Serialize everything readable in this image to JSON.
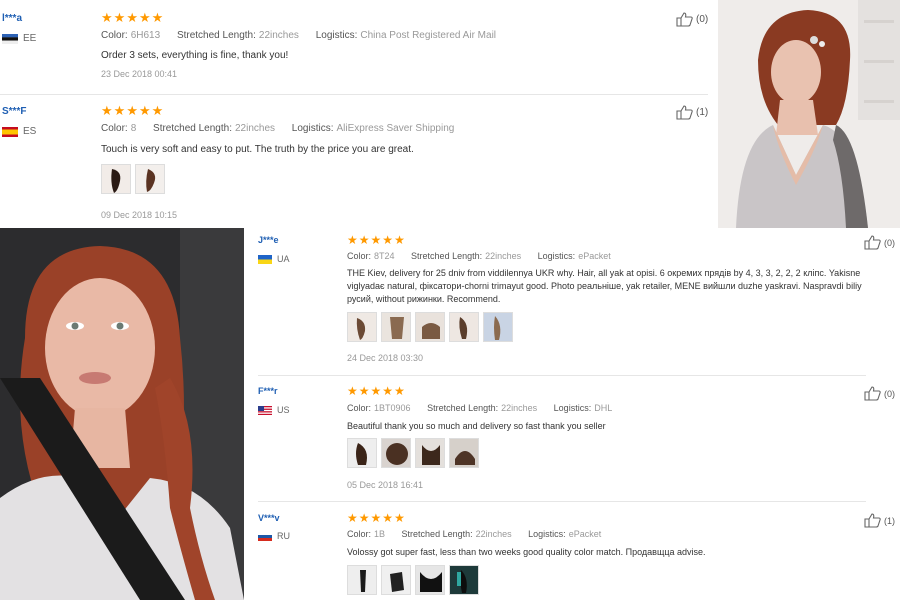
{
  "reviews_top": [
    {
      "user": "l***a",
      "country": "EE",
      "color_label": "Color:",
      "color": "6H613",
      "length_label": "Stretched Length:",
      "length": "22inches",
      "logistics_label": "Logistics:",
      "logistics": "China Post Registered Air Mail",
      "text": "Order 3 sets, everything is fine, thank you!",
      "date": "23 Dec 2018 00:41",
      "likes": "(0)"
    },
    {
      "user": "S***F",
      "country": "ES",
      "color_label": "Color:",
      "color": "8",
      "length_label": "Stretched Length:",
      "length": "22inches",
      "logistics_label": "Logistics:",
      "logistics": "AliExpress Saver Shipping",
      "text": "Touch is very soft and easy to put. The truth by the price you are great.",
      "date": "09 Dec 2018 10:15",
      "likes": "(1)"
    }
  ],
  "reviews_bottom": [
    {
      "user": "J***e",
      "country": "UA",
      "color_label": "Color:",
      "color": "8T24",
      "length_label": "Stretched Length:",
      "length": "22inches",
      "logistics_label": "Logistics:",
      "logistics": "ePacket",
      "text": "THE Kiev, delivery for 25 dniv from viddilennya UKR why. Hair, all yak at opisi. 6 окремих прядів by 4, 3, 3, 2, 2, 2 кліпс. Yakisne viglyadає natural, фіксатори-chorni trimayut good. Photo реальніше, yak retailer, MENE вийшли duzhe yaskravi. Naspravdi biliy русий, without рижинки. Recommend.",
      "date": "24 Dec 2018 03:30",
      "likes": "(0)"
    },
    {
      "user": "F***r",
      "country": "US",
      "color_label": "Color:",
      "color": "1BT0906",
      "length_label": "Stretched Length:",
      "length": "22inches",
      "logistics_label": "Logistics:",
      "logistics": "DHL",
      "text": "Beautiful thank you so much and delivery so fast thank you seller",
      "date": "05 Dec 2018 16:41",
      "likes": "(0)"
    },
    {
      "user": "V***v",
      "country": "RU",
      "color_label": "Color:",
      "color": "1B",
      "length_label": "Stretched Length:",
      "length": "22inches",
      "logistics_label": "Logistics:",
      "logistics": "ePacket",
      "text": "Volossy got super fast, less than two weeks good quality color match. Продавщца advise.",
      "likes": "(1)"
    }
  ],
  "colors": {
    "star": "#ff9900",
    "username": "#1f5fb3",
    "hair": "#a0442a"
  }
}
